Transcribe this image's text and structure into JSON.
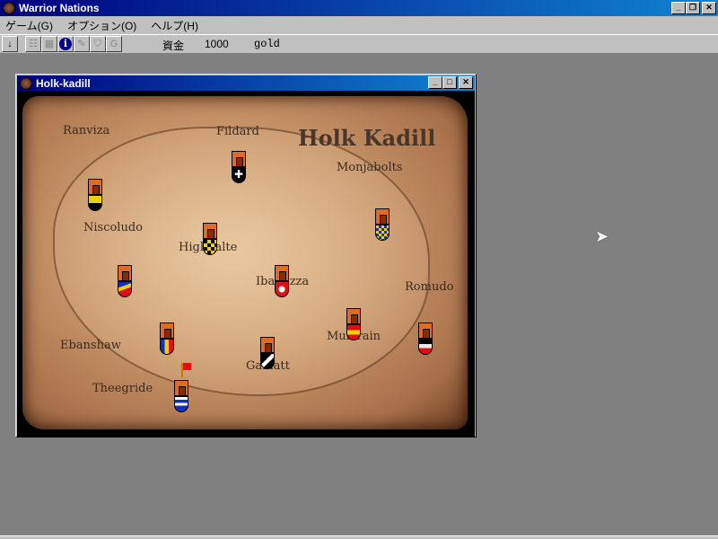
{
  "app": {
    "title": "Warrior Nations"
  },
  "menu": [
    {
      "label": "ゲーム(G)"
    },
    {
      "label": "オプション(O)"
    },
    {
      "label": "ヘルプ(H)"
    }
  ],
  "toolbar": {
    "money_label": "資金",
    "money_value": "1000",
    "money_unit": "gold"
  },
  "map_window": {
    "title": "Holk-kadill",
    "map_title": "Holk Kadill",
    "regions": [
      "Ranviza",
      "Fildard",
      "Monjabolts",
      "Niscoludo",
      "Highdalte",
      "Ibamizza",
      "Romudo",
      "Ebanshaw",
      "Mulerain",
      "Galliatt",
      "Theegride"
    ]
  },
  "colors": {
    "titlebar": "#000080",
    "face": "#c0c0c0",
    "desktop": "#808080"
  }
}
